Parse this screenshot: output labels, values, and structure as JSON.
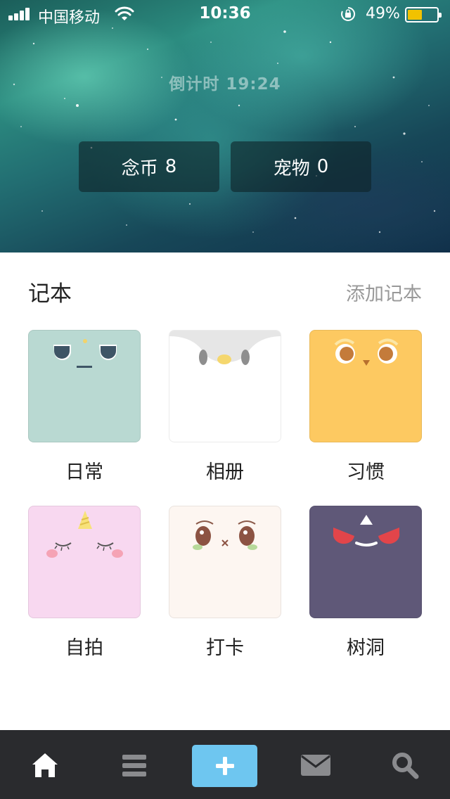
{
  "status_bar": {
    "carrier": "中国移动",
    "time": "10:36",
    "battery_percent_label": "49%",
    "battery_level": 0.49,
    "icons": [
      "signal-icon",
      "wifi-icon",
      "orientation-lock-icon",
      "battery-icon"
    ]
  },
  "hero": {
    "countdown": "倒计时 19:24",
    "coins": {
      "label": "念币",
      "value": "8"
    },
    "pets": {
      "label": "宠物",
      "value": "0"
    }
  },
  "notebooks": {
    "title": "记本",
    "add_label": "添加记本",
    "items": [
      {
        "label": "日常",
        "color": "#b9d9d2",
        "face": "grumpy-face-icon"
      },
      {
        "label": "相册",
        "color": "#ffffff",
        "face": "penguin-face-icon"
      },
      {
        "label": "习惯",
        "color": "#fdc961",
        "face": "owl-face-icon"
      },
      {
        "label": "自拍",
        "color": "#f8d8f0",
        "face": "unicorn-face-icon"
      },
      {
        "label": "打卡",
        "color": "#fdf6f1",
        "face": "shy-face-icon"
      },
      {
        "label": "树洞",
        "color": "#5f5878",
        "face": "devil-face-icon"
      }
    ]
  },
  "tabbar": {
    "accent": "#6ec6f0",
    "background": "#2a2b2e",
    "tabs": [
      "home-icon",
      "menu-icon",
      "add-icon",
      "mail-icon",
      "search-icon"
    ]
  }
}
